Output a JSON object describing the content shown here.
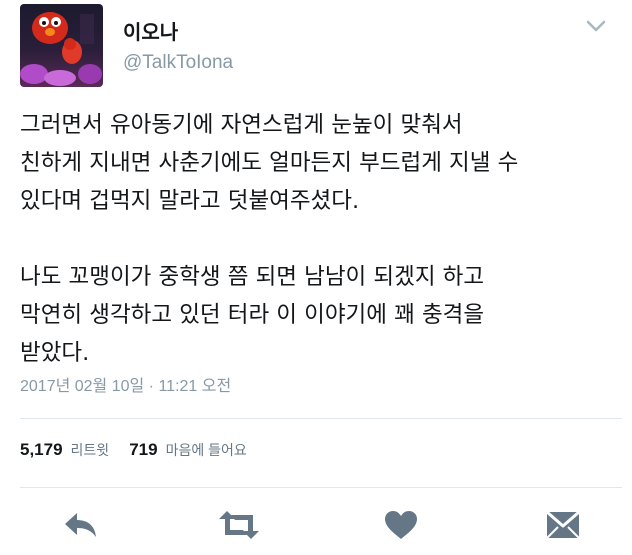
{
  "user": {
    "display_name": "이오나",
    "handle": "@TalkToIona"
  },
  "tweet": {
    "lines": [
      "그러면서 유아동기에 자연스럽게 눈높이 맞춰서",
      "친하게 지내면 사춘기에도 얼마든지 부드럽게 지낼 수",
      "있다며 겁먹지 말라고 덧붙여주셨다.",
      "",
      "나도 꼬맹이가 중학생 쯤 되면 남남이 되겠지 하고",
      "막연히 생각하고 있던 터라 이 이야기에 꽤 충격을",
      "받았다."
    ],
    "timestamp": "2017년 02월 10일 · 11:21 오전"
  },
  "stats": {
    "retweets_count": "5,179",
    "retweets_label": "리트윗",
    "likes_count": "719",
    "likes_label": "마음에 들어요"
  },
  "icons": {
    "reply": "reply-icon",
    "retweet": "retweet-icon",
    "like": "heart-icon",
    "message": "envelope-icon",
    "more": "chevron-down-icon"
  },
  "colors": {
    "icon_gray": "#657786",
    "text": "#14171a",
    "secondary": "#8899a6",
    "divider": "#e1e8ed"
  }
}
